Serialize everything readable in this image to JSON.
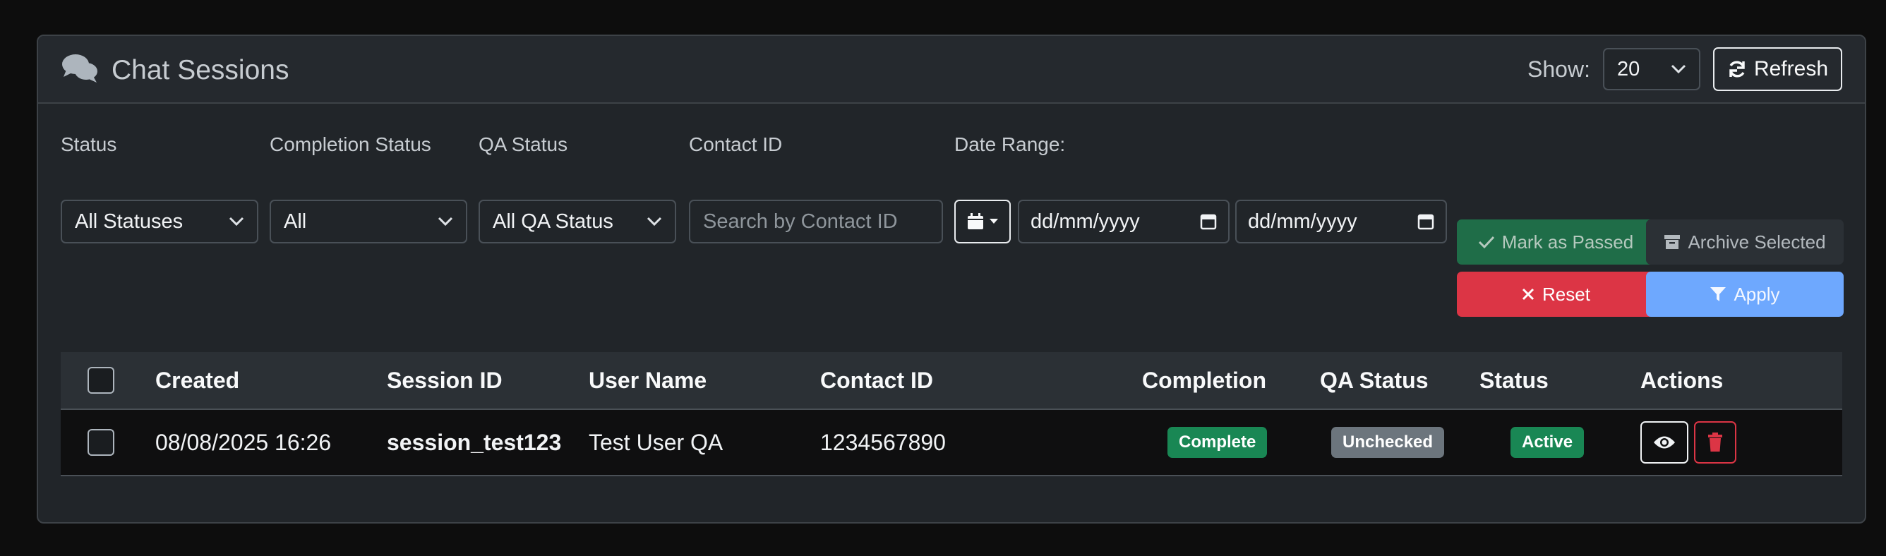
{
  "header": {
    "title": "Chat Sessions",
    "title_icon": "chat-bubbles-icon",
    "show_label": "Show:",
    "page_size": "20",
    "refresh_label": "Refresh"
  },
  "filters": {
    "status_label": "Status",
    "status_value": "All Statuses",
    "completion_label": "Completion Status",
    "completion_value": "All",
    "qa_label": "QA Status",
    "qa_value": "All QA Status",
    "contact_label": "Contact ID",
    "contact_placeholder": "Search by Contact ID",
    "date_label": "Date Range:",
    "date_from": "dd/mm/yyyy",
    "date_to": "dd/mm/yyyy"
  },
  "actions": {
    "mark_passed": "Mark as Passed",
    "archive": "Archive Selected",
    "reset": "Reset",
    "apply": "Apply"
  },
  "table": {
    "columns": {
      "created": "Created",
      "session_id": "Session ID",
      "user_name": "User Name",
      "contact_id": "Contact ID",
      "completion": "Completion",
      "qa_status": "QA Status",
      "status": "Status",
      "actions": "Actions"
    },
    "rows": [
      {
        "created": "08/08/2025 16:26",
        "session_id": "session_test123",
        "user_name": "Test User QA",
        "contact_id": "1234567890",
        "completion": "Complete",
        "qa_status": "Unchecked",
        "status": "Active"
      }
    ]
  },
  "colors": {
    "success": "#198754",
    "danger": "#dc3545",
    "primary_light": "#6ea8fe",
    "secondary": "#6c757d"
  }
}
